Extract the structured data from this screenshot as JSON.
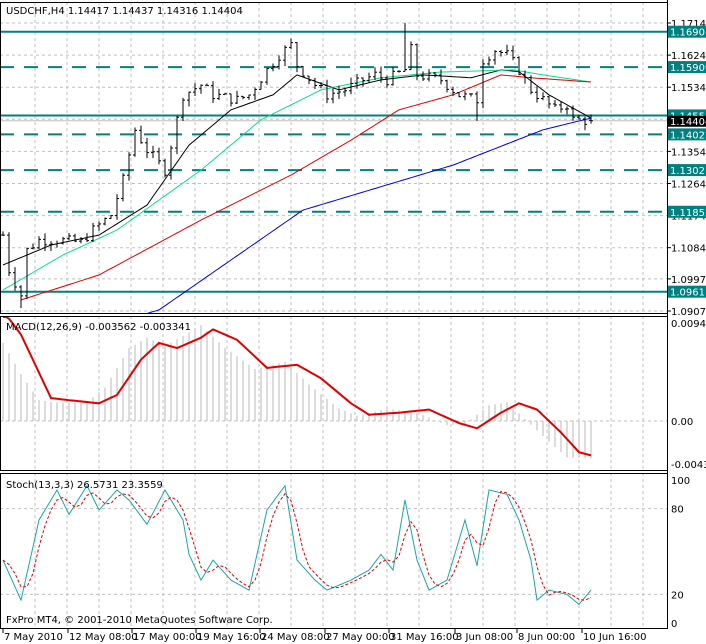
{
  "window": {
    "symbol_header": "USDCHF,H4  1.14417 1.14437 1.14316 1.14404",
    "copyright": "FxPro MT4, © 2001-2010 MetaQuotes Software Corp."
  },
  "colors": {
    "level_line": "#008080",
    "ma_fast": "#000000",
    "ma_mid": "#00e08a",
    "ma_slow": "#e00000",
    "ma_long": "#0000e0",
    "macd_signal": "#e00000",
    "macd_hist": "#b8b8b8",
    "stoch_main": "#1aa5a5",
    "stoch_signal": "#e00000",
    "grid": "#c0c0c0"
  },
  "chart_data": [
    {
      "type": "ohlc",
      "title": "USDCHF,H4",
      "ohlc_last": {
        "open": 1.14417,
        "high": 1.14437,
        "low": 1.14316,
        "close": 1.14404
      },
      "ylim": [
        1.0907,
        1.17145
      ],
      "y_ticks": [
        "1.17145",
        "1.16245",
        "1.15345",
        "1.14445",
        "1.13545",
        "1.12645",
        "1.11745",
        "1.10845",
        "1.09970",
        "1.09070"
      ],
      "x_ticks": [
        "7 May 2010",
        "12 May 08:00",
        "17 May 00:00",
        "19 May 16:00",
        "24 May 08:00",
        "27 May 00:00",
        "31 May 16:00",
        "3 Jun 08:00",
        "8 Jun 00:00",
        "10 Jun 16:00"
      ],
      "current_price": "1.14404",
      "levels": [
        {
          "price": "1.16901",
          "style": "solid"
        },
        {
          "price": "1.15909",
          "style": "dashed"
        },
        {
          "price": "1.14553",
          "style": "solid"
        },
        {
          "price": "1.14022",
          "style": "dashed"
        },
        {
          "price": "1.13021",
          "style": "dashed"
        },
        {
          "price": "1.11852",
          "style": "dashed"
        },
        {
          "price": "1.09611",
          "style": "solid"
        }
      ],
      "bars": 99,
      "close_path": [
        [
          0,
          1.112
        ],
        [
          1,
          1.1022
        ],
        [
          3,
          1.0952
        ],
        [
          4,
          1.1078
        ],
        [
          6,
          1.1106
        ],
        [
          9,
          1.1106
        ],
        [
          13,
          1.11
        ],
        [
          15,
          1.1134
        ],
        [
          18,
          1.1176
        ],
        [
          20,
          1.1274
        ],
        [
          22,
          1.1415
        ],
        [
          24,
          1.1358
        ],
        [
          27,
          1.1302
        ],
        [
          29,
          1.1443
        ],
        [
          30,
          1.1513
        ],
        [
          33,
          1.1541
        ],
        [
          35,
          1.1513
        ],
        [
          39,
          1.1499
        ],
        [
          41,
          1.1513
        ],
        [
          44,
          1.1583
        ],
        [
          46,
          1.1625
        ],
        [
          48,
          1.1653
        ],
        [
          49,
          1.1597
        ],
        [
          52,
          1.1541
        ],
        [
          54,
          1.1513
        ],
        [
          57,
          1.1527
        ],
        [
          60,
          1.1555
        ],
        [
          62,
          1.1569
        ],
        [
          64,
          1.1555
        ],
        [
          67,
          1.1583
        ],
        [
          68,
          1.164
        ],
        [
          69,
          1.1569
        ],
        [
          73,
          1.1555
        ],
        [
          76,
          1.1513
        ],
        [
          79,
          1.1499
        ],
        [
          80,
          1.1611
        ],
        [
          82,
          1.1639
        ],
        [
          84,
          1.1625
        ],
        [
          86,
          1.1583
        ],
        [
          88,
          1.1527
        ],
        [
          89,
          1.1513
        ],
        [
          92,
          1.1471
        ],
        [
          94,
          1.1485
        ],
        [
          95,
          1.1443
        ],
        [
          98,
          1.144
        ]
      ],
      "moving_averages": [
        {
          "name": "ma_fast",
          "points": [
            [
              0,
              1.1036
            ],
            [
              8,
              1.1092
            ],
            [
              16,
              1.112
            ],
            [
              24,
              1.1204
            ],
            [
              31,
              1.1372
            ],
            [
              38,
              1.1471
            ],
            [
              45,
              1.1513
            ],
            [
              49,
              1.1569
            ],
            [
              56,
              1.1527
            ],
            [
              63,
              1.1555
            ],
            [
              70,
              1.1569
            ],
            [
              78,
              1.1561
            ],
            [
              83,
              1.1583
            ],
            [
              86,
              1.1578
            ],
            [
              91,
              1.1513
            ],
            [
              98,
              1.1448
            ]
          ]
        },
        {
          "name": "ma_mid",
          "points": [
            [
              0,
              1.0966
            ],
            [
              10,
              1.1064
            ],
            [
              19,
              1.1134
            ],
            [
              33,
              1.1302
            ],
            [
              43,
              1.1443
            ],
            [
              53,
              1.1527
            ],
            [
              63,
              1.1561
            ],
            [
              73,
              1.1577
            ],
            [
              85,
              1.1583
            ],
            [
              90,
              1.1569
            ],
            [
              98,
              1.1549
            ]
          ]
        },
        {
          "name": "ma_slow",
          "points": [
            [
              3,
              1.0938
            ],
            [
              16,
              1.1008
            ],
            [
              33,
              1.1162
            ],
            [
              48,
              1.1288
            ],
            [
              58,
              1.1386
            ],
            [
              66,
              1.1471
            ],
            [
              75,
              1.1513
            ],
            [
              83,
              1.1569
            ],
            [
              88,
              1.1561
            ],
            [
              98,
              1.1549
            ]
          ]
        },
        {
          "name": "ma_long",
          "points": [
            [
              20,
              1.088
            ],
            [
              26,
              1.091
            ],
            [
              50,
              1.119
            ],
            [
              75,
              1.1316
            ],
            [
              90,
              1.1415
            ],
            [
              98,
              1.1448
            ]
          ]
        }
      ]
    },
    {
      "type": "line+bar",
      "title": "MACD(12,26,9) -0.003562 -0.003341",
      "ylim": [
        -0.00434,
        0.00941
      ],
      "y_ticks": [
        "0.00941",
        "0.00",
        "-0.00434"
      ],
      "signal": [
        [
          0,
          0.0106
        ],
        [
          3,
          0.0083
        ],
        [
          8,
          0.0022
        ],
        [
          11,
          0.002
        ],
        [
          16,
          0.0017
        ],
        [
          19,
          0.0025
        ],
        [
          23,
          0.0059
        ],
        [
          26,
          0.0075
        ],
        [
          29,
          0.007
        ],
        [
          33,
          0.008
        ],
        [
          35,
          0.0088
        ],
        [
          39,
          0.0078
        ],
        [
          44,
          0.0051
        ],
        [
          49,
          0.0054
        ],
        [
          53,
          0.0041
        ],
        [
          58,
          0.0017
        ],
        [
          61,
          0.0006
        ],
        [
          66,
          0.0008
        ],
        [
          71,
          0.0011
        ],
        [
          76,
          -0.0002
        ],
        [
          79,
          -0.0007
        ],
        [
          83,
          0.0008
        ],
        [
          86,
          0.0017
        ],
        [
          89,
          0.0011
        ],
        [
          93,
          -0.0011
        ],
        [
          96,
          -0.003
        ],
        [
          98,
          -0.0033
        ]
      ],
      "histogram": [
        [
          0,
          0.0075
        ],
        [
          3,
          0.0045
        ],
        [
          6,
          0.002
        ],
        [
          10,
          0.0017
        ],
        [
          14,
          0.0018
        ],
        [
          17,
          0.0032
        ],
        [
          21,
          0.007
        ],
        [
          24,
          0.008
        ],
        [
          27,
          0.0072
        ],
        [
          31,
          0.0085
        ],
        [
          33,
          0.0092
        ],
        [
          37,
          0.007
        ],
        [
          42,
          0.005
        ],
        [
          47,
          0.0057
        ],
        [
          51,
          0.0035
        ],
        [
          56,
          0.0012
        ],
        [
          59,
          0.0005
        ],
        [
          64,
          0.0012
        ],
        [
          69,
          0.0008
        ],
        [
          74,
          -0.0004
        ],
        [
          77,
          -0.0003
        ],
        [
          81,
          0.0015
        ],
        [
          84,
          0.0018
        ],
        [
          87,
          0.0002
        ],
        [
          91,
          -0.002
        ],
        [
          94,
          -0.0035
        ],
        [
          98,
          -0.0036
        ]
      ]
    },
    {
      "type": "line",
      "title": "Stoch(13,3,3) 26.5731 23.3559",
      "ylim": [
        0,
        100
      ],
      "y_ticks": [
        "100",
        "80",
        "20",
        "0"
      ],
      "main": [
        [
          0,
          44
        ],
        [
          3,
          16
        ],
        [
          6,
          72
        ],
        [
          9,
          93
        ],
        [
          11,
          76
        ],
        [
          14,
          96
        ],
        [
          16,
          79
        ],
        [
          19,
          93
        ],
        [
          21,
          86
        ],
        [
          24,
          69
        ],
        [
          27,
          93
        ],
        [
          30,
          72
        ],
        [
          31,
          48
        ],
        [
          33,
          30
        ],
        [
          35,
          44
        ],
        [
          38,
          30
        ],
        [
          41,
          23
        ],
        [
          44,
          79
        ],
        [
          47,
          96
        ],
        [
          49,
          44
        ],
        [
          52,
          30
        ],
        [
          54,
          23
        ],
        [
          58,
          30
        ],
        [
          61,
          37
        ],
        [
          63,
          48
        ],
        [
          65,
          37
        ],
        [
          67,
          86
        ],
        [
          69,
          44
        ],
        [
          71,
          23
        ],
        [
          74,
          30
        ],
        [
          77,
          72
        ],
        [
          79,
          40
        ],
        [
          81,
          93
        ],
        [
          84,
          90
        ],
        [
          86,
          72
        ],
        [
          88,
          44
        ],
        [
          89,
          16
        ],
        [
          91,
          23
        ],
        [
          94,
          20
        ],
        [
          96,
          13
        ],
        [
          98,
          23
        ]
      ]
    }
  ]
}
